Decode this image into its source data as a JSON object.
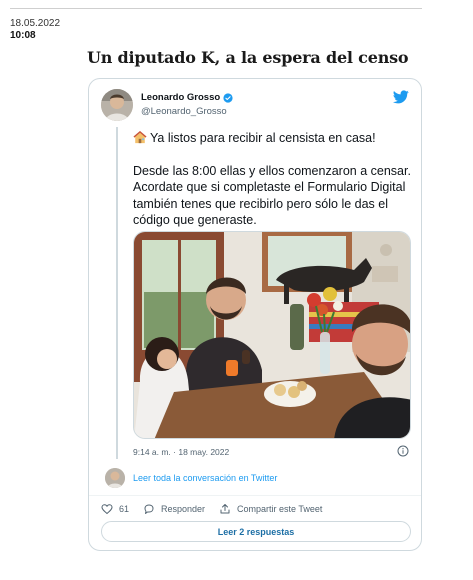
{
  "article": {
    "date": "18.05.2022",
    "time": "10:08",
    "headline": "Un diputado K, a la espera del censo"
  },
  "tweet": {
    "author_name": "Leonardo Grosso",
    "author_handle": "@Leonardo_Grosso",
    "text_paragraphs": [
      "Ya listos para recibir al censista en casa!",
      "Desde las 8:00 ellas y ellos comenzaron a censar. Acordate que si completaste el Formulario Digital también tenes que recibirlo pero sólo le das el código que generaste."
    ],
    "timestamp": "9:14 a. m. · 18 may. 2022",
    "conversation_link": "Leer toda la conversación en Twitter",
    "like_count": "61",
    "reply_label": "Responder",
    "share_label": "Compartir este Tweet",
    "read_replies_label": "Leer 2 respuestas"
  },
  "icons": {
    "verified": "verified-badge-icon",
    "brand": "twitter-bird-icon",
    "info": "info-icon",
    "like": "heart-icon",
    "reply": "reply-icon",
    "share": "share-icon",
    "house": "house-emoji-icon"
  },
  "colors": {
    "accent": "#1d9bf0",
    "text": "#0f1419",
    "muted": "#536471",
    "border": "#cfd9de"
  }
}
